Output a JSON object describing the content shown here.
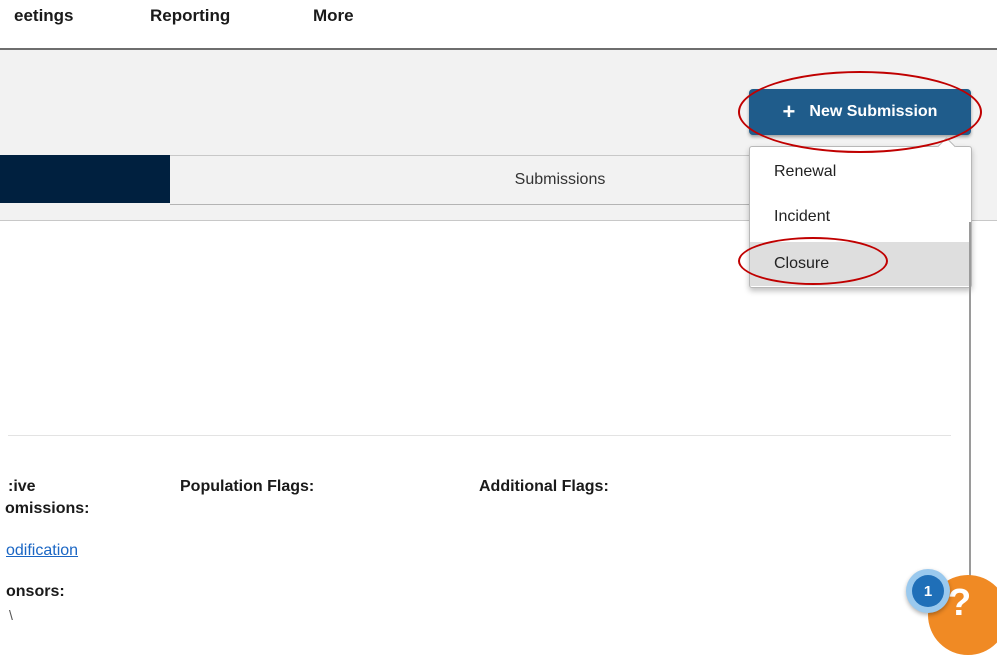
{
  "nav": {
    "items": [
      {
        "label": "eetings"
      },
      {
        "label": "Reporting"
      },
      {
        "label": "More"
      }
    ]
  },
  "tabs": {
    "submissions_label": "Submissions"
  },
  "new_submission": {
    "icon": "plus-icon",
    "label": "New Submission",
    "accent_color": "#1f5c8b"
  },
  "dropdown": {
    "items": [
      {
        "label": "Renewal"
      },
      {
        "label": "Incident"
      },
      {
        "label": "Closure",
        "state": "hovered"
      }
    ]
  },
  "details": {
    "col1_label_line1": ":ive",
    "col1_label_line2": "omissions:",
    "col1_link": "odification",
    "col1_label2": "onsors:",
    "col1_value": "\\",
    "population_flags_label": "Population Flags:",
    "additional_flags_label": "Additional Flags:"
  },
  "help": {
    "badge_count": "1",
    "symbol": "?",
    "color": "#f08a24"
  },
  "annotation_color": "#c00000"
}
